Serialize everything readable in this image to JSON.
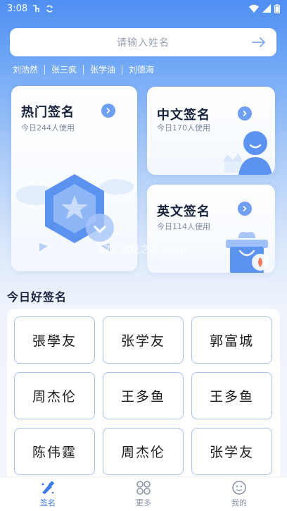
{
  "status": {
    "time": "3:08"
  },
  "search": {
    "placeholder": "请输入姓名"
  },
  "history": [
    "刘浩然",
    "张三疯",
    "张学油",
    "刘德海"
  ],
  "cards": {
    "hot": {
      "title": "热门签名",
      "sub": "今日244人使用"
    },
    "chinese": {
      "title": "中文签名",
      "sub": "今日170人使用"
    },
    "english": {
      "title": "英文签名",
      "sub": "今日114人使用"
    }
  },
  "section": {
    "title": "今日好签名"
  },
  "signatures": [
    "張學友",
    "张学友",
    "郭富城",
    "周杰伦",
    "王多鱼",
    "王多鱼",
    "陈伟霆",
    "周杰伦",
    "张学友"
  ],
  "tabs": {
    "sign": "签名",
    "more": "更多",
    "mine": "我的"
  },
  "watermark": "k73 游戏之家 .com",
  "colors": {
    "accent": "#3d7bea",
    "card_arrow": "#6f9ff3",
    "cell_border": "#a9c3ef"
  }
}
